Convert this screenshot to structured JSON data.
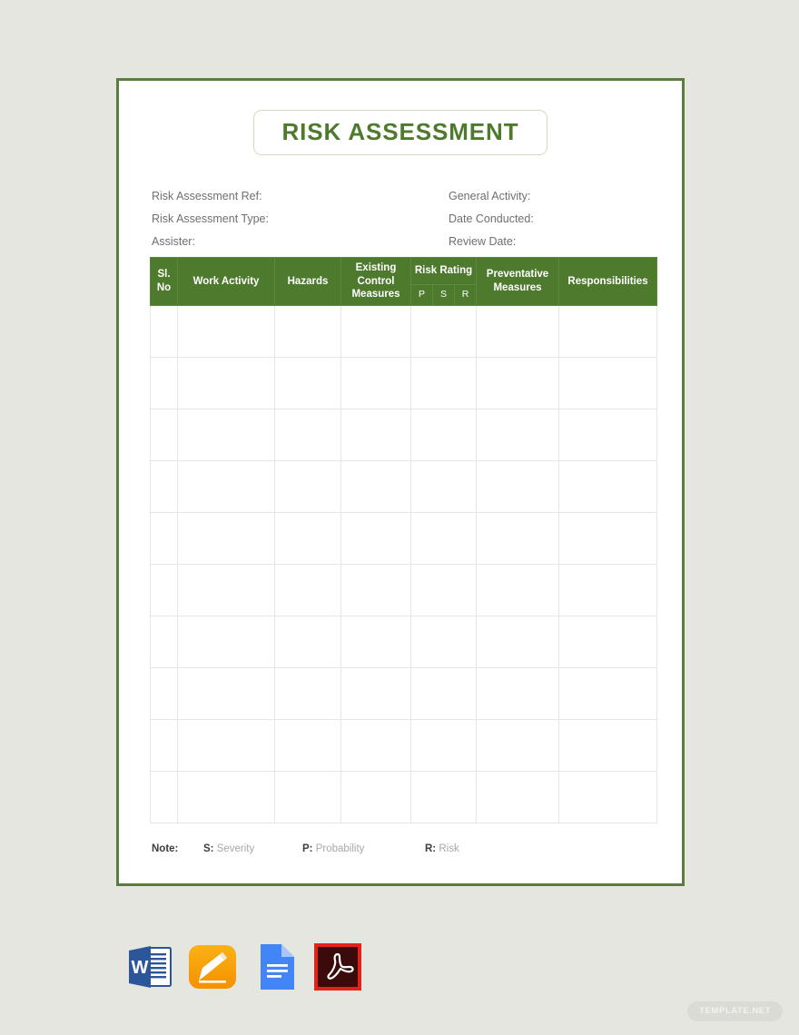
{
  "document": {
    "title": "RISK ASSESSMENT"
  },
  "meta": {
    "left": [
      "Risk Assessment Ref:",
      "Risk Assessment Type:",
      "Assister:"
    ],
    "right": [
      "General Activity:",
      "Date Conducted:",
      "Review Date:"
    ]
  },
  "table": {
    "headers": {
      "sl_no": "Sl. No",
      "work_activity": "Work Activity",
      "hazards": "Hazards",
      "existing_control_measures": "Existing Control Measures",
      "risk_rating": "Risk Rating",
      "risk_p": "P",
      "risk_s": "S",
      "risk_r": "R",
      "preventative_measures": "Preventative Measures",
      "responsibilities": "Responsibilities"
    },
    "row_count": 10,
    "rows": [
      {
        "sl_no": "",
        "work_activity": "",
        "hazards": "",
        "existing_control_measures": "",
        "risk_rating": "",
        "preventative_measures": "",
        "responsibilities": ""
      },
      {
        "sl_no": "",
        "work_activity": "",
        "hazards": "",
        "existing_control_measures": "",
        "risk_rating": "",
        "preventative_measures": "",
        "responsibilities": ""
      },
      {
        "sl_no": "",
        "work_activity": "",
        "hazards": "",
        "existing_control_measures": "",
        "risk_rating": "",
        "preventative_measures": "",
        "responsibilities": ""
      },
      {
        "sl_no": "",
        "work_activity": "",
        "hazards": "",
        "existing_control_measures": "",
        "risk_rating": "",
        "preventative_measures": "",
        "responsibilities": ""
      },
      {
        "sl_no": "",
        "work_activity": "",
        "hazards": "",
        "existing_control_measures": "",
        "risk_rating": "",
        "preventative_measures": "",
        "responsibilities": ""
      },
      {
        "sl_no": "",
        "work_activity": "",
        "hazards": "",
        "existing_control_measures": "",
        "risk_rating": "",
        "preventative_measures": "",
        "responsibilities": ""
      },
      {
        "sl_no": "",
        "work_activity": "",
        "hazards": "",
        "existing_control_measures": "",
        "risk_rating": "",
        "preventative_measures": "",
        "responsibilities": ""
      },
      {
        "sl_no": "",
        "work_activity": "",
        "hazards": "",
        "existing_control_measures": "",
        "risk_rating": "",
        "preventative_measures": "",
        "responsibilities": ""
      },
      {
        "sl_no": "",
        "work_activity": "",
        "hazards": "",
        "existing_control_measures": "",
        "risk_rating": "",
        "preventative_measures": "",
        "responsibilities": ""
      },
      {
        "sl_no": "",
        "work_activity": "",
        "hazards": "",
        "existing_control_measures": "",
        "risk_rating": "",
        "preventative_measures": "",
        "responsibilities": ""
      }
    ]
  },
  "note": {
    "label": "Note:",
    "items": [
      {
        "key": "S:",
        "value": "Severity"
      },
      {
        "key": "P:",
        "value": "Probability"
      },
      {
        "key": "R:",
        "value": "Risk"
      }
    ]
  },
  "file_formats": [
    {
      "name": "ms-word-icon",
      "label": "MS Word"
    },
    {
      "name": "apple-pages-icon",
      "label": "Apple Pages"
    },
    {
      "name": "google-docs-icon",
      "label": "Google Docs"
    },
    {
      "name": "pdf-icon",
      "label": "PDF"
    }
  ],
  "watermark": {
    "text": "TEMPLATE.NET"
  },
  "colors": {
    "page_background": "#e4e6df",
    "sheet_border": "#5a7c3d",
    "header_green": "#4e7a2e",
    "title_green": "#4e7a2e",
    "title_box_border": "#cfdcc0",
    "grid_line": "#e6e6e6",
    "meta_text": "#6f6f6f",
    "note_key": "#3d3d3d",
    "note_value": "#a8a8a8"
  }
}
